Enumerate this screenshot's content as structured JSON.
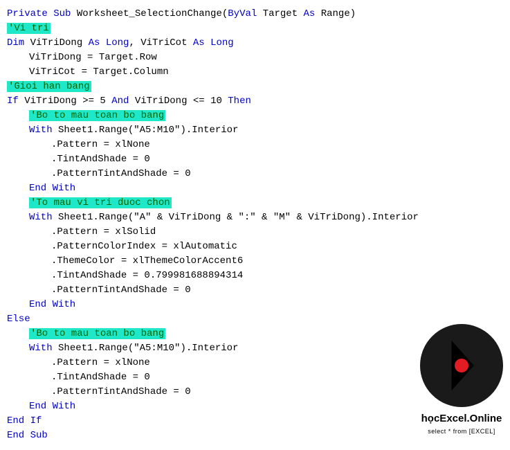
{
  "lines": [
    {
      "indent": 0,
      "parts": [
        {
          "t": "Private Sub",
          "c": "kw-blue"
        },
        {
          "t": " Worksheet_SelectionChange(",
          "c": "black"
        },
        {
          "t": "ByVal",
          "c": "kw-blue"
        },
        {
          "t": " Target ",
          "c": "black"
        },
        {
          "t": "As",
          "c": "kw-blue"
        },
        {
          "t": " Range)",
          "c": "black"
        }
      ]
    },
    {
      "indent": 0,
      "parts": [
        {
          "t": "'Vi tri",
          "c": "highlight"
        }
      ]
    },
    {
      "indent": 0,
      "parts": [
        {
          "t": "Dim",
          "c": "kw-blue"
        },
        {
          "t": " ViTriDong ",
          "c": "black"
        },
        {
          "t": "As Long",
          "c": "kw-blue"
        },
        {
          "t": ", ViTriCot ",
          "c": "black"
        },
        {
          "t": "As Long",
          "c": "kw-blue"
        }
      ]
    },
    {
      "indent": 1,
      "parts": [
        {
          "t": "ViTriDong = Target.Row",
          "c": "black"
        }
      ]
    },
    {
      "indent": 1,
      "parts": [
        {
          "t": "ViTriCot = Target.Column",
          "c": "black"
        }
      ]
    },
    {
      "indent": 0,
      "parts": [
        {
          "t": "'Gioi han bang",
          "c": "highlight"
        }
      ]
    },
    {
      "indent": 0,
      "parts": [
        {
          "t": "If",
          "c": "kw-blue"
        },
        {
          "t": " ViTriDong >= 5 ",
          "c": "black"
        },
        {
          "t": "And",
          "c": "kw-blue"
        },
        {
          "t": " ViTriDong <= 10 ",
          "c": "black"
        },
        {
          "t": "Then",
          "c": "kw-blue"
        }
      ]
    },
    {
      "indent": 1,
      "parts": [
        {
          "t": "'Bo to mau toan bo bang",
          "c": "highlight"
        }
      ]
    },
    {
      "indent": 1,
      "parts": [
        {
          "t": "With",
          "c": "kw-blue"
        },
        {
          "t": " Sheet1.Range(\"A5:M10\").Interior",
          "c": "black"
        }
      ]
    },
    {
      "indent": 2,
      "parts": [
        {
          "t": ".Pattern = xlNone",
          "c": "black"
        }
      ]
    },
    {
      "indent": 2,
      "parts": [
        {
          "t": ".TintAndShade = 0",
          "c": "black"
        }
      ]
    },
    {
      "indent": 2,
      "parts": [
        {
          "t": ".PatternTintAndShade = 0",
          "c": "black"
        }
      ]
    },
    {
      "indent": 1,
      "parts": [
        {
          "t": "End With",
          "c": "kw-blue"
        }
      ]
    },
    {
      "indent": 1,
      "parts": [
        {
          "t": "'To mau vi tri duoc chon",
          "c": "highlight"
        }
      ]
    },
    {
      "indent": 1,
      "parts": [
        {
          "t": "With",
          "c": "kw-blue"
        },
        {
          "t": " Sheet1.Range(\"A\" & ViTriDong & \":\" & \"M\" & ViTriDong).Interior",
          "c": "black"
        }
      ]
    },
    {
      "indent": 2,
      "parts": [
        {
          "t": ".Pattern = xlSolid",
          "c": "black"
        }
      ]
    },
    {
      "indent": 2,
      "parts": [
        {
          "t": ".PatternColorIndex = xlAutomatic",
          "c": "black"
        }
      ]
    },
    {
      "indent": 2,
      "parts": [
        {
          "t": ".ThemeColor = xlThemeColorAccent6",
          "c": "black"
        }
      ]
    },
    {
      "indent": 2,
      "parts": [
        {
          "t": ".TintAndShade = 0.799981688894314",
          "c": "black"
        }
      ]
    },
    {
      "indent": 2,
      "parts": [
        {
          "t": ".PatternTintAndShade = 0",
          "c": "black"
        }
      ]
    },
    {
      "indent": 1,
      "parts": [
        {
          "t": "End With",
          "c": "kw-blue"
        }
      ]
    },
    {
      "indent": 0,
      "parts": [
        {
          "t": "Else",
          "c": "kw-blue"
        }
      ]
    },
    {
      "indent": 1,
      "parts": [
        {
          "t": "'Bo to mau toan bo bang",
          "c": "highlight"
        }
      ]
    },
    {
      "indent": 1,
      "parts": [
        {
          "t": "With",
          "c": "kw-blue"
        },
        {
          "t": " Sheet1.Range(\"A5:M10\").Interior",
          "c": "black"
        }
      ]
    },
    {
      "indent": 2,
      "parts": [
        {
          "t": ".Pattern = xlNone",
          "c": "black"
        }
      ]
    },
    {
      "indent": 2,
      "parts": [
        {
          "t": ".TintAndShade = 0",
          "c": "black"
        }
      ]
    },
    {
      "indent": 2,
      "parts": [
        {
          "t": ".PatternTintAndShade = 0",
          "c": "black"
        }
      ]
    },
    {
      "indent": 1,
      "parts": [
        {
          "t": "End With",
          "c": "kw-blue"
        }
      ]
    },
    {
      "indent": 0,
      "parts": [
        {
          "t": "End If",
          "c": "kw-blue"
        }
      ]
    },
    {
      "indent": 0,
      "parts": [
        {
          "t": "End Sub",
          "c": "kw-blue"
        }
      ]
    }
  ],
  "logo": {
    "text": "họcExcel.Online",
    "subtext": "select * from [EXCEL]"
  }
}
